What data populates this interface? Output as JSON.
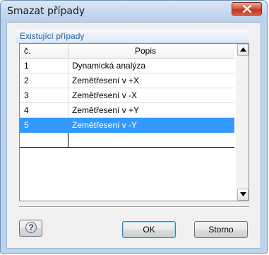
{
  "window": {
    "title": "Smazat případy"
  },
  "group": {
    "label": "Existující případy"
  },
  "table": {
    "columns": [
      "č.",
      "Popis"
    ],
    "rows": [
      {
        "num": "1",
        "desc": "Dynamická analýza"
      },
      {
        "num": "2",
        "desc": "Zemětřesení v +X"
      },
      {
        "num": "3",
        "desc": "Zemětřesení v -X"
      },
      {
        "num": "4",
        "desc": "Zemětřesení v +Y"
      },
      {
        "num": "5",
        "desc": "Zemětřesení v -Y"
      }
    ],
    "selected_row": "5"
  },
  "buttons": {
    "ok": "OK",
    "cancel": "Storno"
  },
  "colors": {
    "selection": "#3399ff",
    "group_label": "#1f5fa8",
    "close_button": "#c0341d"
  },
  "icons": [
    "close-icon",
    "help-icon",
    "scroll-up-icon",
    "scroll-down-icon"
  ]
}
